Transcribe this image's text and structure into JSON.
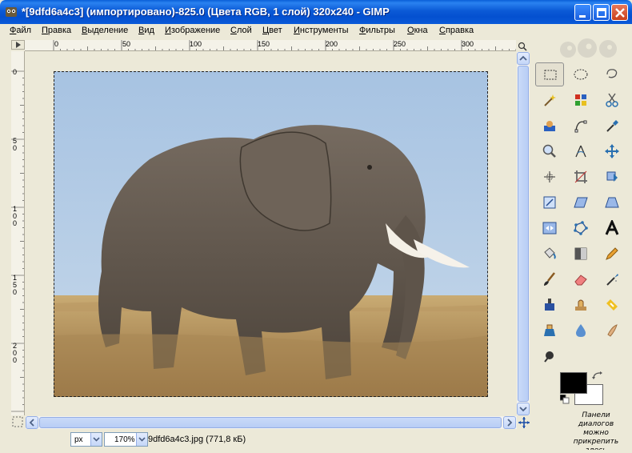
{
  "window": {
    "title": "*[9dfd6a4c3] (импортировано)-825.0 (Цвета RGB, 1 слой) 320x240 - GIMP"
  },
  "menu": [
    {
      "label": "Файл",
      "key": "Ф",
      "rest": "айл"
    },
    {
      "label": "Правка",
      "key": "П",
      "rest": "равка"
    },
    {
      "label": "Выделение",
      "key": "В",
      "rest": "ыделение"
    },
    {
      "label": "Вид",
      "key": "В",
      "rest": "ид"
    },
    {
      "label": "Изображение",
      "key": "И",
      "rest": "зображение"
    },
    {
      "label": "Слой",
      "key": "С",
      "rest": "лой"
    },
    {
      "label": "Цвет",
      "key": "Ц",
      "rest": "вет"
    },
    {
      "label": "Инструменты",
      "key": "И",
      "rest": "нструменты"
    },
    {
      "label": "Фильтры",
      "key": "Ф",
      "rest": "ильтры"
    },
    {
      "label": "Окна",
      "key": "О",
      "rest": "кна"
    },
    {
      "label": "Справка",
      "key": "С",
      "rest": "правка"
    }
  ],
  "rulers": {
    "horizontal_labels": [
      "0",
      "50",
      "100",
      "150",
      "200",
      "250",
      "300"
    ],
    "vertical_labels": [
      "0",
      "50",
      "100",
      "150",
      "200"
    ]
  },
  "statusbar": {
    "unit": "px",
    "zoom": "170%",
    "file_info": "9dfd6a4c3.jpg (771,8 кБ)"
  },
  "toolbox": {
    "tools": [
      "rect-select-icon",
      "ellipse-select-icon",
      "lasso-icon",
      "fuzzy-select-icon",
      "color-select-icon",
      "scissors-icon",
      "foreground-select-icon",
      "paths-icon",
      "color-picker-icon",
      "zoom-icon",
      "measure-icon",
      "move-icon",
      "align-icon",
      "crop-icon",
      "rotate-icon",
      "scale-icon",
      "shear-icon",
      "perspective-icon",
      "flip-icon",
      "cage-icon",
      "text-icon",
      "bucket-fill-icon",
      "blend-icon",
      "pencil-icon",
      "paintbrush-icon",
      "eraser-icon",
      "airbrush-icon",
      "ink-icon",
      "clone-icon",
      "heal-icon",
      "perspective-clone-icon",
      "blur-icon",
      "smudge-icon",
      "dodge-burn-icon"
    ],
    "dock_hint_lines": [
      "Панели",
      "диалогов",
      "можно",
      "прикрепить",
      "здесь"
    ],
    "fg_color": "#000000",
    "bg_color": "#ffffff"
  },
  "colors": {
    "titlebar": "#0a5ad8",
    "selection_border": "#222222"
  }
}
